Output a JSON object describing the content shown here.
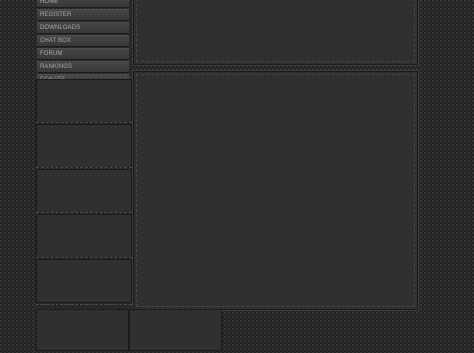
{
  "nav": {
    "items": [
      {
        "label": "HOME"
      },
      {
        "label": "REGISTER"
      },
      {
        "label": "DOWNLOADS"
      },
      {
        "label": "CHAT BOX"
      },
      {
        "label": "FORUM"
      },
      {
        "label": "RANKINGS"
      },
      {
        "label": "DONATE"
      }
    ]
  }
}
